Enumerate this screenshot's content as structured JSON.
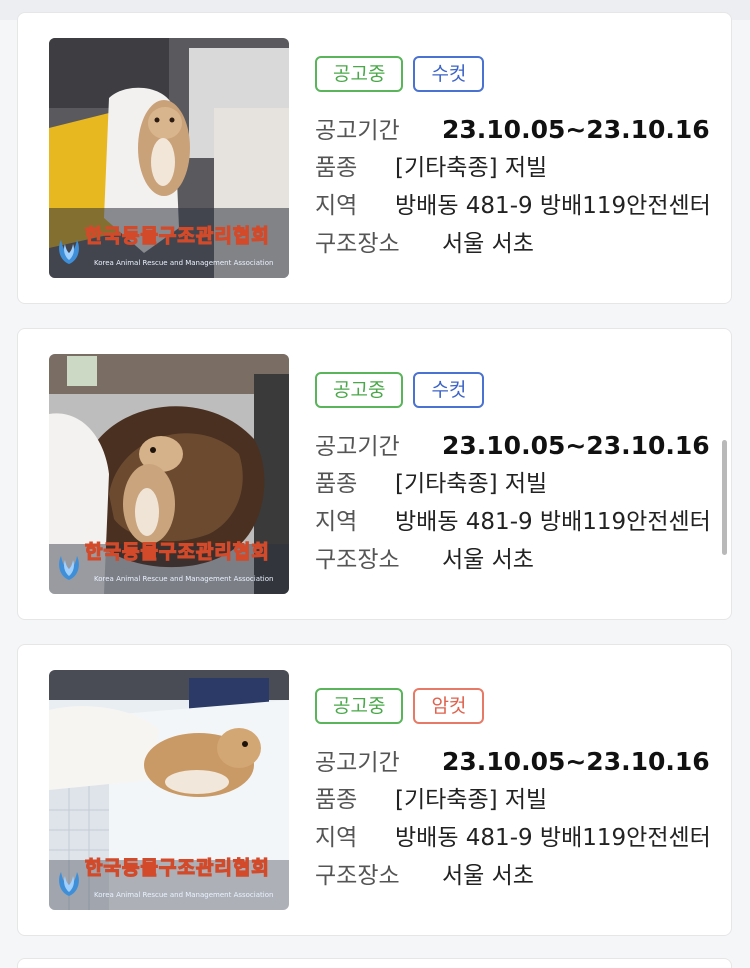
{
  "labels": {
    "period": "공고기간",
    "breed": "품종",
    "region": "지역",
    "rescue_place": "구조장소"
  },
  "watermark": {
    "name": "한국동물구조관리협회",
    "english": "Korea Animal Rescue and Management Association"
  },
  "listings": [
    {
      "status": "공고중",
      "sex": "수컷",
      "period": "23.10.05~23.10.16",
      "breed": "[기타축종] 저빌",
      "region": "방배동 481-9 방배119안전센터",
      "rescue_place": "서울 서초",
      "photo_icon": "gerbil-held-in-glove-photo"
    },
    {
      "status": "공고중",
      "sex": "수컷",
      "period": "23.10.05~23.10.16",
      "breed": "[기타축종] 저빌",
      "region": "방배동 481-9 방배119안전센터",
      "rescue_place": "서울 서초",
      "photo_icon": "gerbil-in-coconut-shell-photo"
    },
    {
      "status": "공고중",
      "sex": "암컷",
      "period": "23.10.05~23.10.16",
      "breed": "[기타축종] 저빌",
      "region": "방배동 481-9 방배119안전센터",
      "rescue_place": "서울 서초",
      "photo_icon": "gerbil-on-plastic-box-photo"
    }
  ],
  "colors": {
    "status_green": "#59b45a",
    "male_blue": "#4a72d0",
    "female_red": "#e77a66"
  }
}
